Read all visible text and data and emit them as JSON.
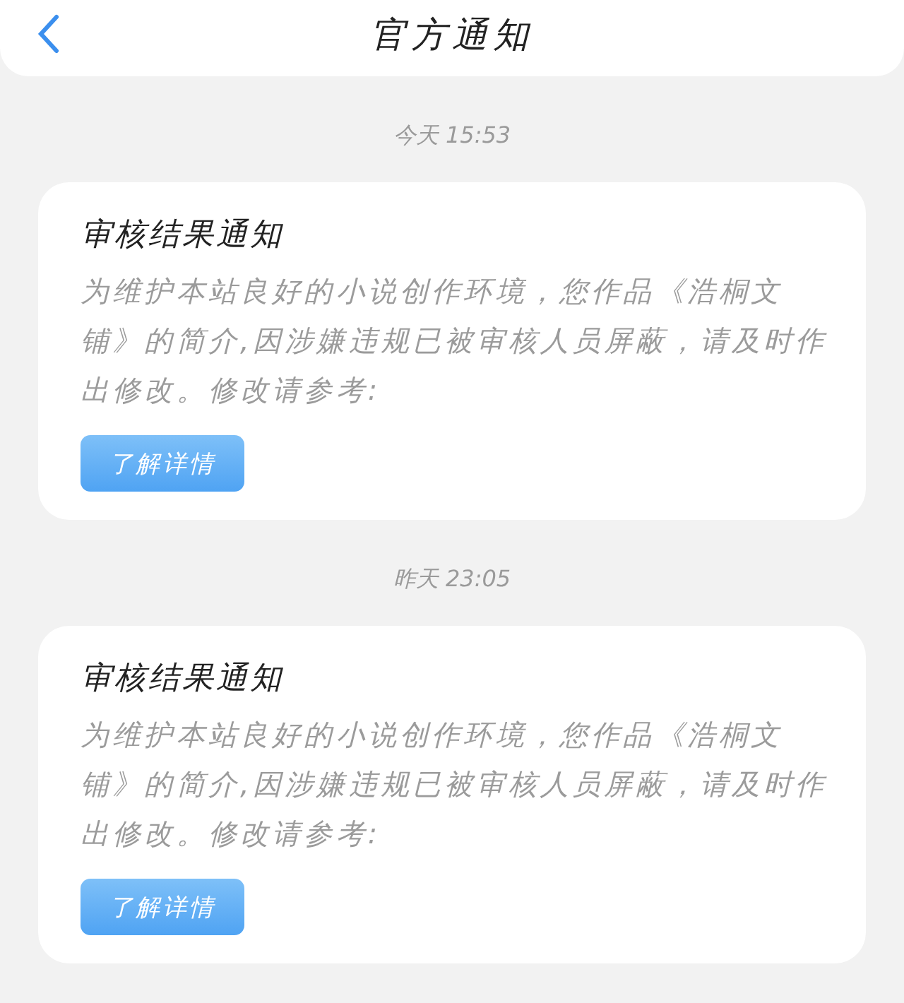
{
  "header": {
    "title": "官方通知"
  },
  "notifications": [
    {
      "time": "今天 15:53",
      "title": "审核结果通知",
      "body": "为维护本站良好的小说创作环境，您作品《浩桐文铺》的简介,因涉嫌违规已被审核人员屏蔽，请及时作出修改。修改请参考:",
      "button": "了解详情"
    },
    {
      "time": "昨天 23:05",
      "title": "审核结果通知",
      "body": "为维护本站良好的小说创作环境，您作品《浩桐文铺》的简介,因涉嫌违规已被审核人员屏蔽，请及时作出修改。修改请参考:",
      "button": "了解详情"
    }
  ]
}
